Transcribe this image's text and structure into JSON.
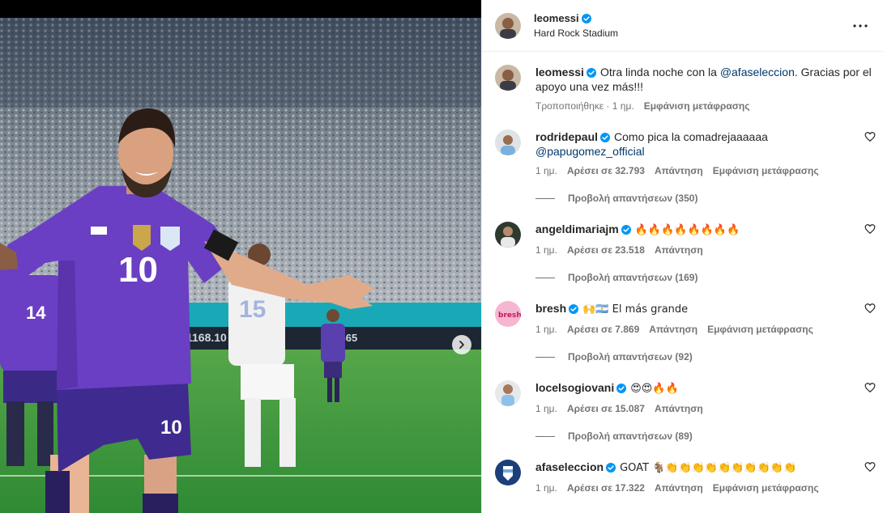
{
  "post": {
    "username": "leomessi",
    "location": "Hard Rock Stadium"
  },
  "photo": {
    "alt": "",
    "jersey_number": "10",
    "player_left_number": "14",
    "player_back_number": "15"
  },
  "caption": {
    "username": "leomessi",
    "text_before": "Otra linda noche con la ",
    "mention": "@afaseleccion",
    "text_after": ". Gracias por el apoyo una vez más!!!",
    "edited": "Τροποποιήθηκε · 1 ημ.",
    "see_translation": "Εμφάνιση μετάφρασης"
  },
  "comments": [
    {
      "username": "rodridepaul",
      "text": "Como pica la comadrejaaaaaa",
      "mention": "@papugomez_official",
      "time": "1 ημ.",
      "likes": "Αρέσει σε 32.793",
      "reply": "Απάντηση",
      "see_translation": "Εμφάνιση μετάφρασης",
      "view_replies": "Προβολή απαντήσεων (350)"
    },
    {
      "username": "angeldimariajm",
      "text": "🔥🔥🔥🔥🔥🔥🔥🔥",
      "time": "1 ημ.",
      "likes": "Αρέσει σε 23.518",
      "reply": "Απάντηση",
      "view_replies": "Προβολή απαντήσεων (169)"
    },
    {
      "username": "bresh",
      "text": "🙌🇦🇷 El más grande",
      "time": "1 ημ.",
      "likes": "Αρέσει σε 7.869",
      "reply": "Απάντηση",
      "see_translation": "Εμφάνιση μετάφρασης",
      "view_replies": "Προβολή απαντήσεων (92)"
    },
    {
      "username": "locelsogiovani",
      "text": "😍😍🔥🔥",
      "time": "1 ημ.",
      "likes": "Αρέσει σε 15.087",
      "reply": "Απάντηση",
      "view_replies": "Προβολή απαντήσεων (89)"
    },
    {
      "username": "afaseleccion",
      "text": "GOAT 🐐👏👏👏👏👏👏👏👏👏👏",
      "time": "1 ημ.",
      "likes": "Αρέσει σε 17.322",
      "reply": "Απάντηση",
      "see_translation": "Εμφάνιση μετάφρασης"
    }
  ],
  "colors": {
    "verified": "#0095f6",
    "mention": "#00376b",
    "meta": "#737373",
    "jersey": "#6a3fc3",
    "pitch": "#3f9a3f"
  },
  "icons": {
    "verified": "verified-badge-icon",
    "more": "more-options-icon",
    "heart": "heart-outline-icon",
    "next": "chevron-right-icon"
  }
}
